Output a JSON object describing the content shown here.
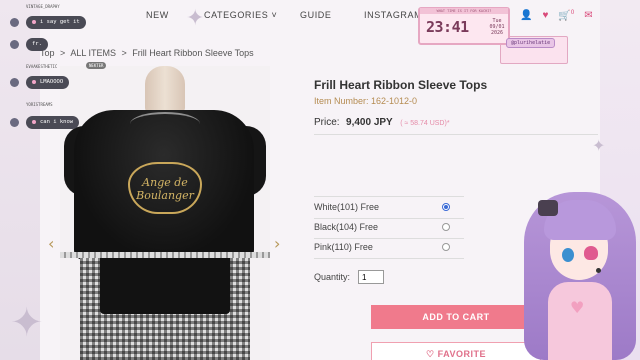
{
  "nav": {
    "items": [
      "NEW",
      "CATEGORIES",
      "GUIDE",
      "INSTAGRAM"
    ],
    "categories_chevron": "˅",
    "cart_count": "0"
  },
  "breadcrumb": {
    "top": "Top",
    "all_items": "ALL ITEMS",
    "current": "Frill Heart Ribbon Sleeve Tops",
    "separator": ">"
  },
  "product": {
    "title": "Frill Heart Ribbon Sleeve Tops",
    "item_number": "Item Number: 162-1012-0",
    "price_label": "Price:",
    "price_value": "9,400 JPY",
    "price_usd": "( ≈ 58.74 USD)*",
    "print_text": "Ange de Boulanger",
    "variants": [
      {
        "label": "White(101) Free",
        "selected": true
      },
      {
        "label": "Black(104) Free",
        "selected": false
      },
      {
        "label": "Pink(110) Free",
        "selected": false
      }
    ],
    "quantity_label": "Quantity:",
    "quantity_value": "1",
    "add_to_cart": "ADD TO CART",
    "favorite": "♡ FAVORITE"
  },
  "chat": {
    "messages": [
      {
        "user": "VINTAGE_DRAPHY",
        "text": "i say get it"
      },
      {
        "user": "",
        "text": "fr."
      },
      {
        "user": "EVAAKESTHETIC",
        "badge": "NEKTER",
        "text": "LMAOOOO"
      },
      {
        "user": "YORISTREAMS",
        "text": "can i know"
      }
    ]
  },
  "clock": {
    "header": "WHAT TIME IS IT FOR KACHI?",
    "time": "23:41",
    "day": "Tue",
    "date": "09/01",
    "year": "2026"
  },
  "streamer_tag": "@plurihelatie",
  "colors": {
    "accent_pink": "#f07a8c",
    "item_number": "#b58c52",
    "radio_selected": "#3a6ad6",
    "usd_pink": "#e58ba8"
  },
  "icons": {
    "user": "user-icon",
    "heart": "heart-icon",
    "cart": "cart-icon",
    "mail": "mail-icon",
    "prev": "chevron-left-icon",
    "next": "chevron-right-icon"
  }
}
